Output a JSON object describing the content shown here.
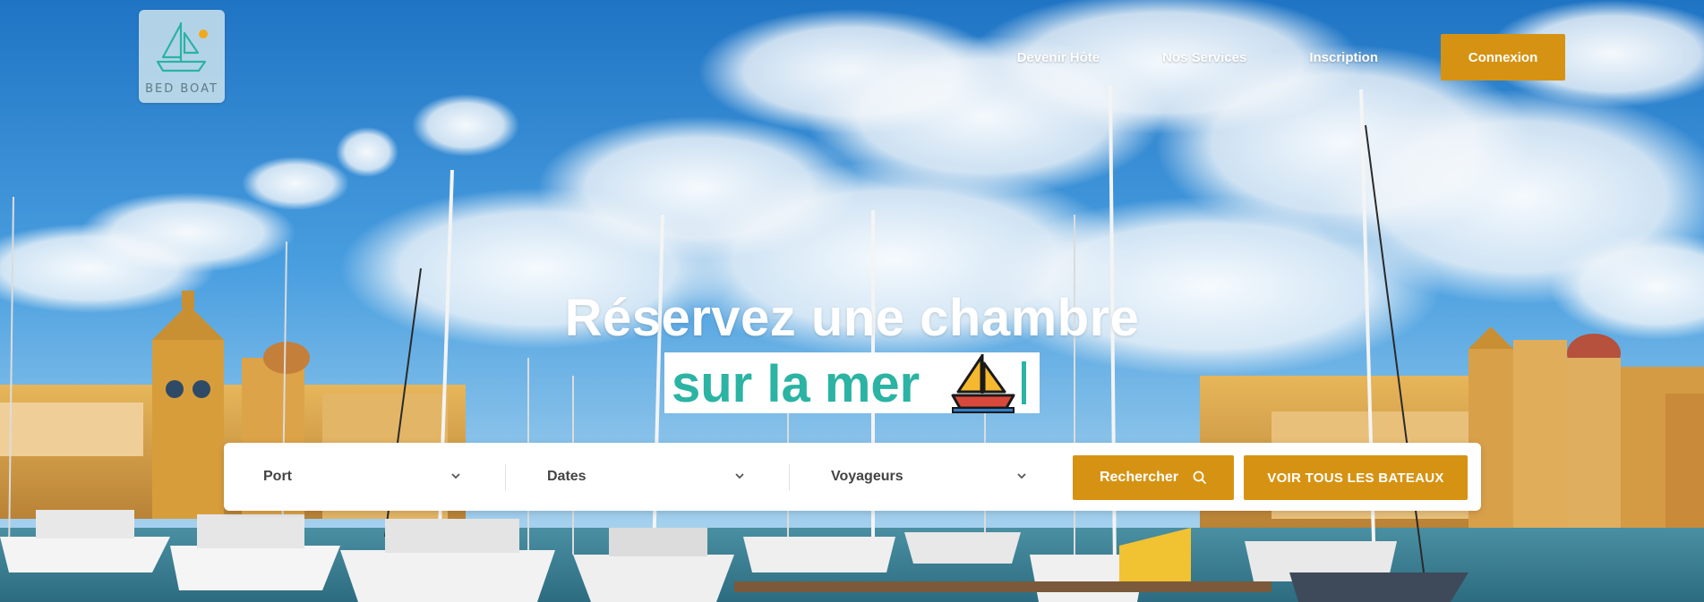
{
  "brand": {
    "name": "BED BOAT"
  },
  "nav": {
    "items": [
      {
        "label": "Devenir Hôte"
      },
      {
        "label": "Nos Services"
      },
      {
        "label": "Inscription"
      }
    ],
    "login_label": "Connexion"
  },
  "hero": {
    "headline_line1": "Réservez une chambre",
    "headline_line2": "sur la mer",
    "emoji_icon": "sailboat-icon",
    "accent_color": "#2bb3a3"
  },
  "search": {
    "port_label": "Port",
    "dates_label": "Dates",
    "travelers_label": "Voyageurs",
    "search_button": "Rechercher",
    "all_boats_button": "VOIR TOUS LES BATEAUX"
  },
  "colors": {
    "primary_button": "#d69313",
    "sky": "#3b8fd6",
    "teal": "#2bb3a3"
  }
}
